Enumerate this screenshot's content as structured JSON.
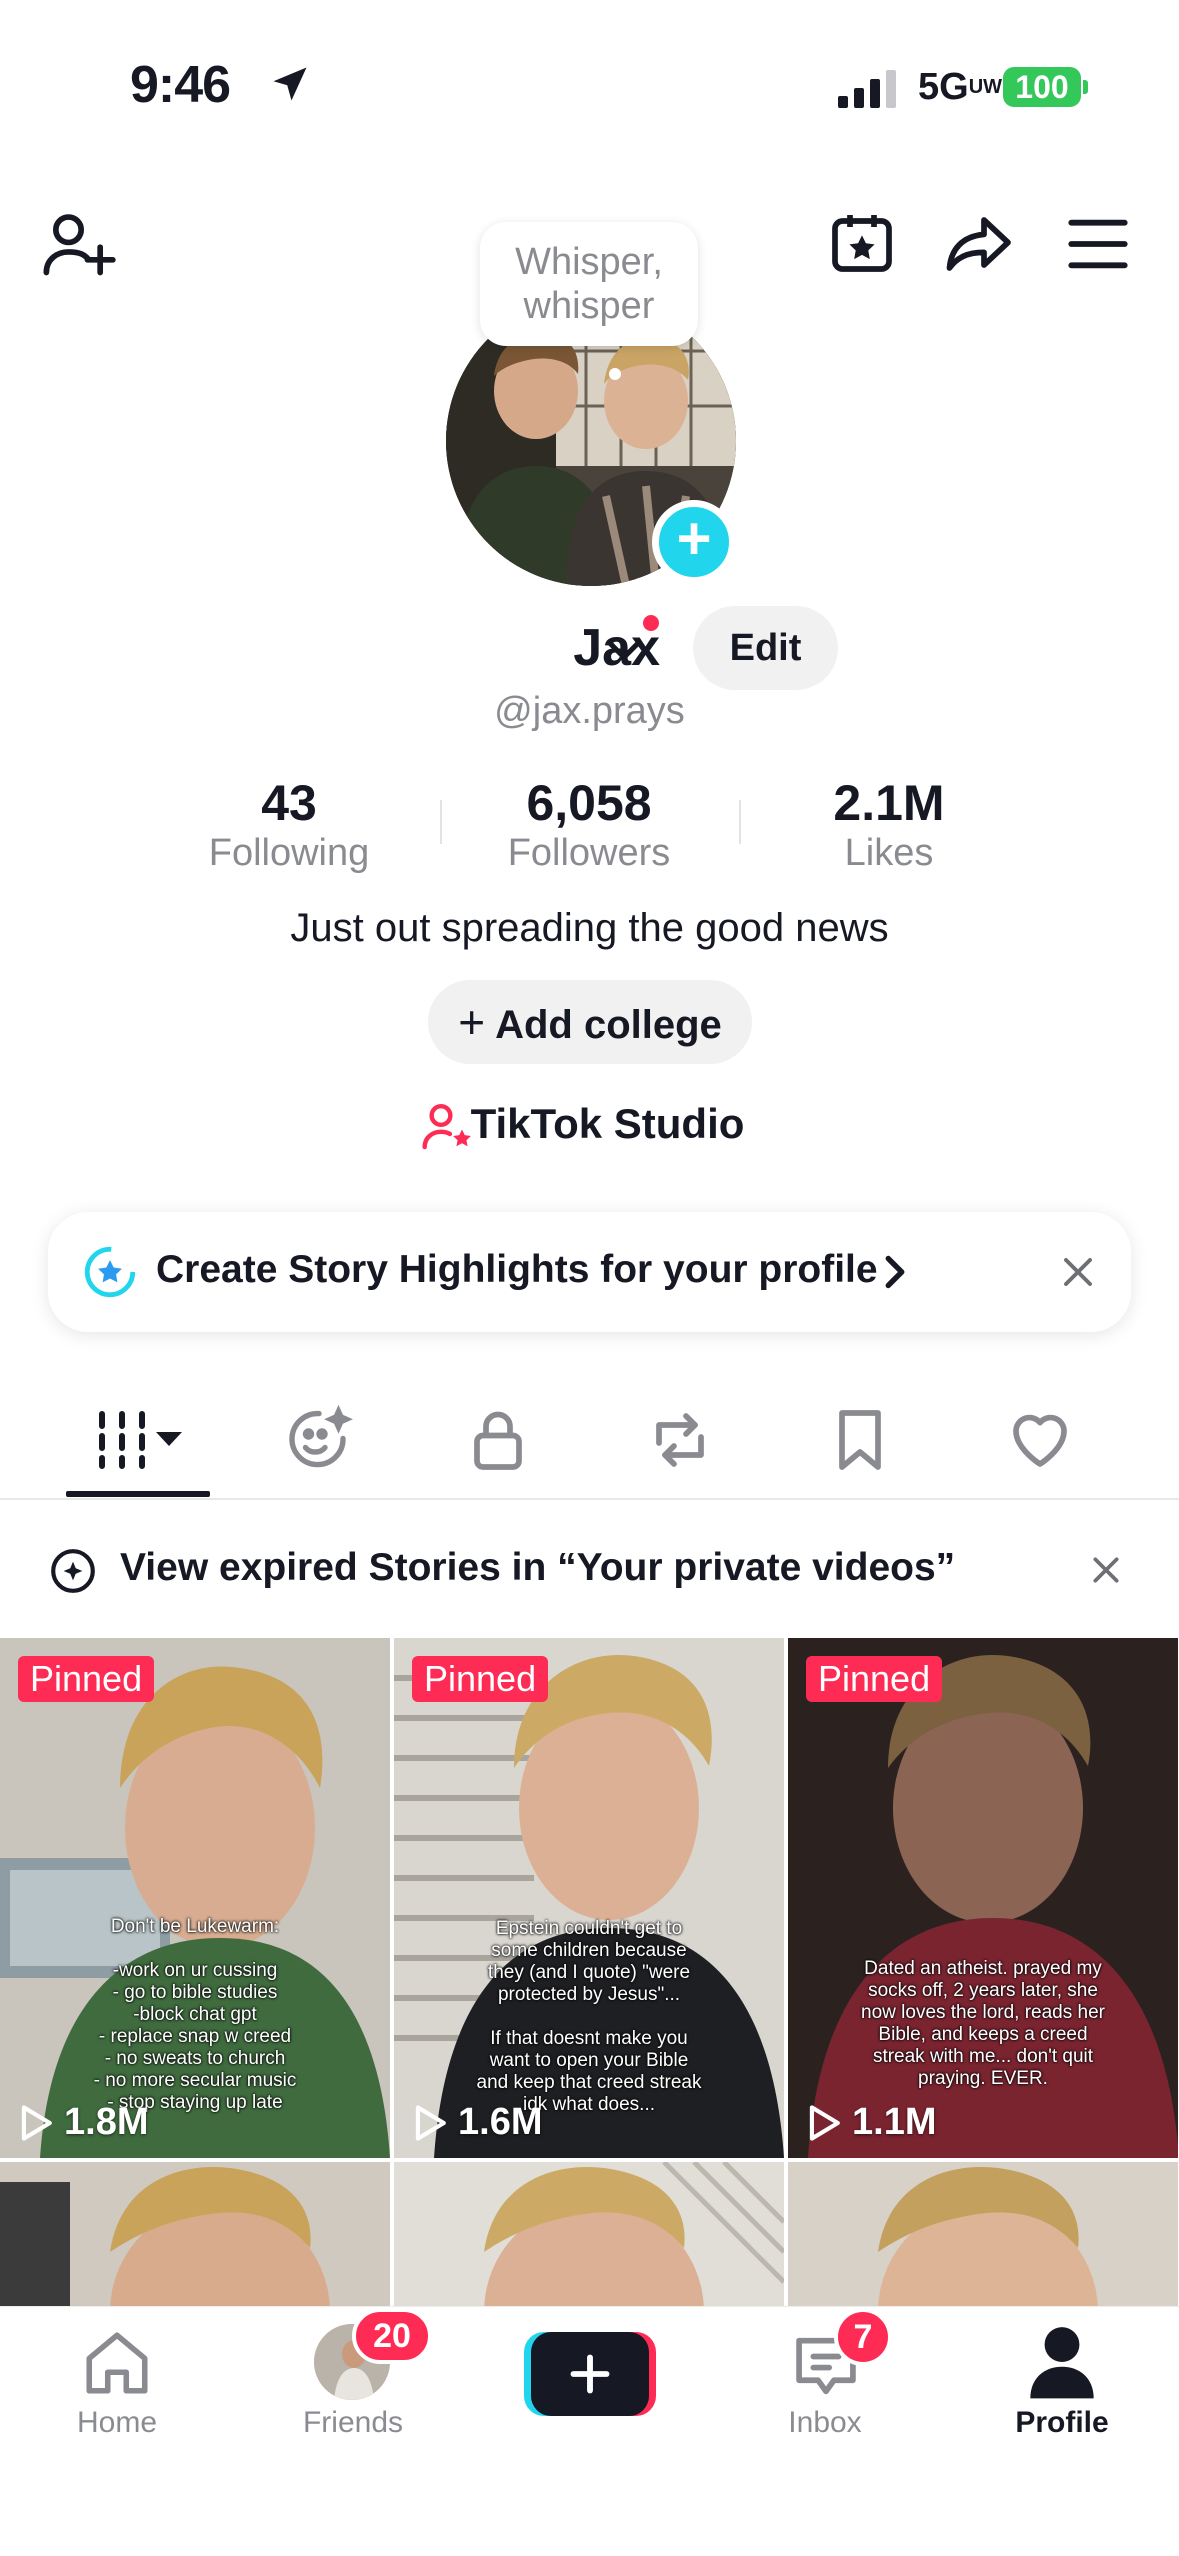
{
  "status_bar": {
    "time": "9:46",
    "network": "5G",
    "network_sup": "UW",
    "battery": "100"
  },
  "profile": {
    "note_bubble": "Whisper, whisper",
    "name": "Jax",
    "edit_label": "Edit",
    "handle": "@jax.prays",
    "stats": [
      {
        "value": "43",
        "label": "Following"
      },
      {
        "value": "6,058",
        "label": "Followers"
      },
      {
        "value": "2.1M",
        "label": "Likes"
      }
    ],
    "bio": "Just out spreading the good news",
    "add_college": "Add college",
    "studio": "TikTok Studio"
  },
  "banners": {
    "highlights": "Create Story Highlights for your profile",
    "expired": "View expired Stories in “Your private videos”"
  },
  "videos": [
    {
      "pinned": "Pinned",
      "views": "1.8M",
      "caption": "Don't be Lukewarm:\n\n-work on ur cussing\n- go to bible studies\n-block chat gpt\n- replace snap w creed\n- no sweats to church\n- no more secular music\n- stop staying up late"
    },
    {
      "pinned": "Pinned",
      "views": "1.6M",
      "caption": "Epstein couldn't get to\nsome children because\nthey (and I quote) \"were\nprotected by Jesus\"...\n\nIf that doesnt make you\nwant to open your Bible\nand keep that creed streak\nidk what does..."
    },
    {
      "pinned": "Pinned",
      "views": "1.1M",
      "caption": "Dated an atheist. prayed my\nsocks off, 2 years later, she\nnow loves the lord, reads her\nBible, and keeps a creed\nstreak with me... don't quit\npraying. EVER."
    }
  ],
  "nav": {
    "home": "Home",
    "friends": "Friends",
    "friends_badge": "20",
    "inbox": "Inbox",
    "inbox_badge": "7",
    "profile": "Profile"
  },
  "colors": {
    "accent": "#fe2c55",
    "cyan": "#20d5ec",
    "battery": "#34c759"
  }
}
